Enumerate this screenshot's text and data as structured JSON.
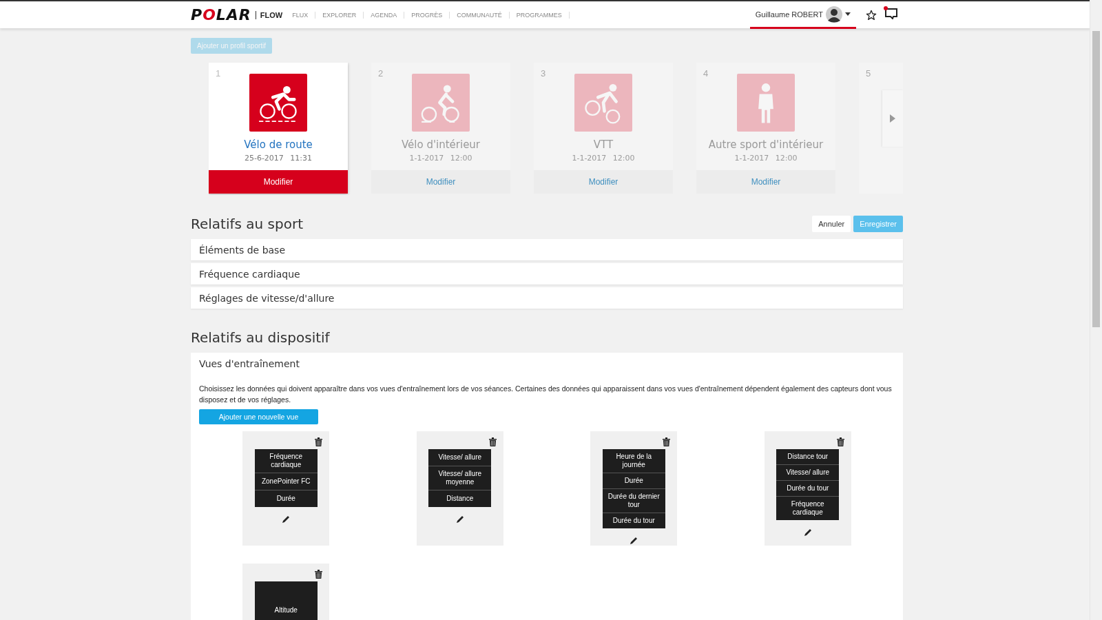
{
  "nav": {
    "logo": "POLAR",
    "product": "FLOW",
    "items": [
      {
        "label": "FLUX"
      },
      {
        "label": "EXPLORER"
      },
      {
        "label": "AGENDA"
      },
      {
        "label": "PROGRÈS"
      },
      {
        "label": "COMMUNAUTÉ"
      },
      {
        "label": "PROGRAMMES"
      }
    ],
    "user": "Guillaume ROBERT",
    "unread_notifications": true
  },
  "add_profile_button": {
    "label": "Ajouter un profil sportif",
    "disabled": true
  },
  "profiles": [
    {
      "number": "1",
      "kind": "road-bike",
      "name": "Vélo de route",
      "date": "25-6-2017",
      "time": "11:31",
      "action": "Modifier",
      "selected": true
    },
    {
      "number": "2",
      "kind": "indoor-bike",
      "name": "Vélo d'intérieur",
      "date": "1-1-2017",
      "time": "12:00",
      "action": "Modifier",
      "selected": false
    },
    {
      "number": "3",
      "kind": "mountain-bike",
      "name": "VTT",
      "date": "1-1-2017",
      "time": "12:00",
      "action": "Modifier",
      "selected": false
    },
    {
      "number": "4",
      "kind": "person",
      "name": "Autre sport d'intérieur",
      "date": "1-1-2017",
      "time": "12:00",
      "action": "Modifier",
      "selected": false
    },
    {
      "number": "5",
      "selected": false
    }
  ],
  "sport_section": {
    "title": "Relatifs au sport",
    "buttons": [
      {
        "label": "Annuler",
        "kind": "secondary"
      },
      {
        "label": "Enregistrer",
        "kind": "primary"
      }
    ],
    "items": [
      {
        "label": "Éléments de base"
      },
      {
        "label": "Fréquence cardiaque"
      },
      {
        "label": "Réglages de vitesse/d'allure"
      }
    ]
  },
  "device_section": {
    "title": "Relatifs au dispositif",
    "panel": {
      "title": "Vues d'entraînement",
      "description": "Choisissez les données qui doivent apparaître dans vos vues d'entraînement lors de vos séances. Certaines des données qui apparaissent dans vos vues d'entraînement dépendent également des capteurs dont vous disposez et de vos réglages.",
      "add_button": "Ajouter une nouvelle vue",
      "views": [
        {
          "fields": [
            "Fréquence cardiaque",
            "ZonePointer FC",
            "Durée"
          ]
        },
        {
          "fields": [
            "Vitesse/ allure",
            "Vitesse/ allure moyenne",
            "Distance"
          ]
        },
        {
          "fields": [
            "Heure de la journée",
            "Durée",
            "Durée du dernier tour",
            "Durée du tour"
          ]
        },
        {
          "fields": [
            "Distance tour",
            "Vitesse/ allure",
            "Durée du tour",
            "Fréquence cardiaque"
          ]
        },
        {
          "fields": [
            "Altitude"
          ]
        }
      ]
    }
  }
}
